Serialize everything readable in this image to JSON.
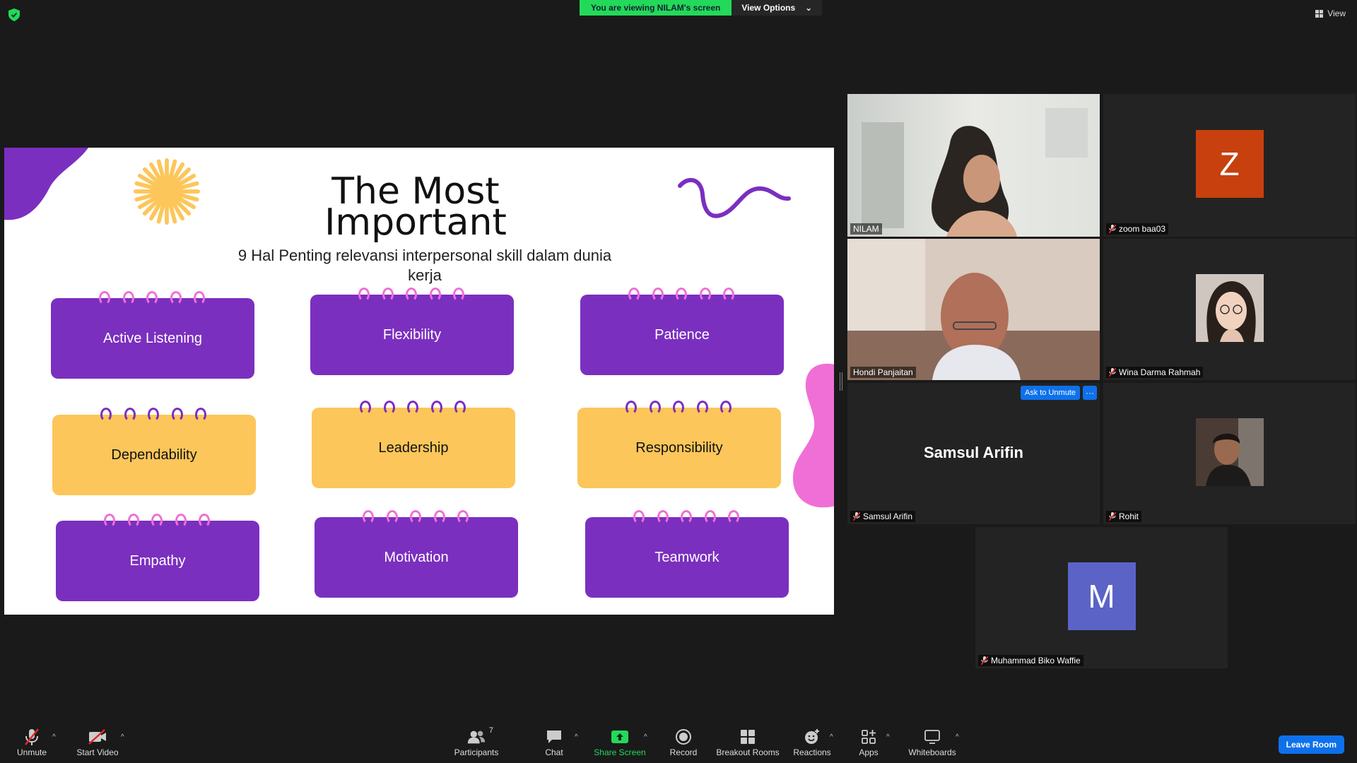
{
  "top_bar": {
    "viewing_text": "You are viewing NILAM's screen",
    "view_options_label": "View Options",
    "view_label": "View"
  },
  "slide": {
    "title_line1": "The Most",
    "title_line2": "Important",
    "subtitle_line1": "9 Hal Penting relevansi interpersonal skill dalam dunia",
    "subtitle_line2": "kerja",
    "cards": [
      {
        "label": "Active Listening",
        "color": "purple"
      },
      {
        "label": "Flexibility",
        "color": "purple"
      },
      {
        "label": "Patience",
        "color": "purple"
      },
      {
        "label": "Dependability",
        "color": "yellow"
      },
      {
        "label": "Leadership",
        "color": "yellow"
      },
      {
        "label": "Responsibility",
        "color": "yellow"
      },
      {
        "label": "Empathy",
        "color": "purple"
      },
      {
        "label": "Motivation",
        "color": "purple"
      },
      {
        "label": "Teamwork",
        "color": "purple"
      }
    ]
  },
  "participants": [
    {
      "name": "NILAM",
      "type": "video",
      "muted": false,
      "active_speaker": true
    },
    {
      "name": "zoom baa03",
      "type": "letter",
      "letter": "Z",
      "avatar_color": "#c8400d",
      "muted": true
    },
    {
      "name": "Hondi Panjaitan",
      "type": "video",
      "muted": false
    },
    {
      "name": "Wina Darma Rahmah",
      "type": "photo",
      "muted": true
    },
    {
      "name": "Samsul Arifin",
      "type": "name",
      "display_name": "Samsul Arifin",
      "muted": true,
      "ask_to_unmute": "Ask to Unmute",
      "more": "···"
    },
    {
      "name": "Rohit",
      "type": "photo",
      "muted": true
    },
    {
      "name": "Muhammad Biko Waffie",
      "type": "letter",
      "letter": "M",
      "avatar_color": "#5b63c7",
      "muted": true
    }
  ],
  "toolbar": {
    "unmute": "Unmute",
    "start_video": "Start Video",
    "participants": "Participants",
    "participants_count": "7",
    "chat": "Chat",
    "share_screen": "Share Screen",
    "record": "Record",
    "breakout_rooms": "Breakout Rooms",
    "reactions": "Reactions",
    "apps": "Apps",
    "whiteboards": "Whiteboards",
    "leave_room": "Leave Room"
  },
  "colors": {
    "accent_green": "#23d959",
    "accent_blue": "#0e71eb",
    "active_speaker": "#d8f35a",
    "slide_purple": "#7b2fbf",
    "slide_yellow": "#fcc65a",
    "slide_pink": "#f06fd6"
  }
}
